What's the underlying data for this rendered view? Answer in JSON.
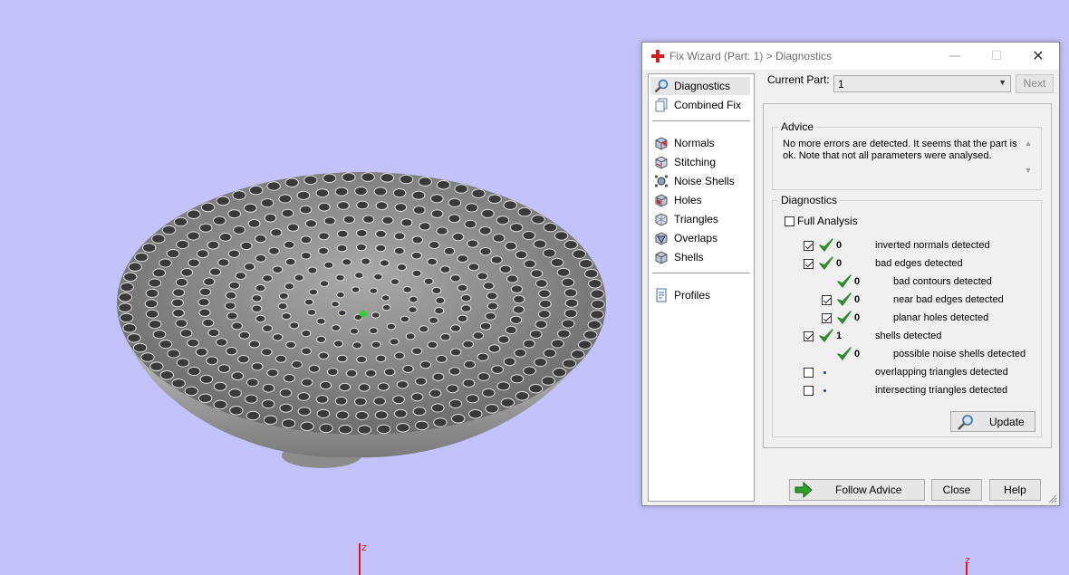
{
  "viewport": {
    "axis_labels": [
      "z",
      "z"
    ],
    "background": "#c3c2fb"
  },
  "dialog": {
    "title": "Fix Wizard (Part: 1) > Diagnostics",
    "window_buttons": {
      "minimize": "—",
      "maximize": "☐",
      "close": "✕"
    },
    "sidebar": {
      "items": [
        {
          "label": "Diagnostics",
          "icon": "magnifier-icon",
          "selected": true
        },
        {
          "label": "Combined Fix",
          "icon": "pages-icon"
        },
        {
          "label": "Normals",
          "icon": "cube-normals-icon"
        },
        {
          "label": "Stitching",
          "icon": "cube-stitch-icon"
        },
        {
          "label": "Noise Shells",
          "icon": "noise-shells-icon"
        },
        {
          "label": "Holes",
          "icon": "cube-holes-icon"
        },
        {
          "label": "Triangles",
          "icon": "triangles-icon"
        },
        {
          "label": "Overlaps",
          "icon": "overlaps-icon"
        },
        {
          "label": "Shells",
          "icon": "shells-icon"
        },
        {
          "label": "Profiles",
          "icon": "document-icon"
        }
      ]
    },
    "current_part": {
      "label": "Current Part:",
      "value": "1",
      "next_label": "Next"
    },
    "advice": {
      "title": "Advice",
      "text": "No more errors are detected. It seems that the part is ok. Note that not all parameters were analysed."
    },
    "diagnostics": {
      "title": "Diagnostics",
      "full_analysis_label": "Full Analysis",
      "full_analysis_checked": false,
      "rows": [
        {
          "checked": true,
          "status": "ok",
          "count": "0",
          "label": "inverted normals detected"
        },
        {
          "checked": true,
          "status": "ok",
          "count": "0",
          "label": "bad edges detected"
        },
        {
          "checked": null,
          "status": "ok",
          "count": "0",
          "label": "bad contours detected"
        },
        {
          "checked": true,
          "status": "ok",
          "count": "0",
          "label": "near bad edges detected"
        },
        {
          "checked": true,
          "status": "ok",
          "count": "0",
          "label": "planar holes detected"
        },
        {
          "checked": true,
          "status": "ok",
          "count": "1",
          "label": "shells detected"
        },
        {
          "checked": null,
          "status": "ok",
          "count": "0",
          "label": "possible noise shells detected"
        },
        {
          "checked": false,
          "status": "unknown",
          "count": "",
          "label": "overlapping triangles detected"
        },
        {
          "checked": false,
          "status": "unknown",
          "count": "",
          "label": "intersecting triangles detected"
        }
      ],
      "update_label": "Update"
    },
    "buttons": {
      "follow_advice": "Follow Advice",
      "close": "Close",
      "help": "Help"
    },
    "colors": {
      "check_green": "#2e8b2e",
      "dot_blue": "#1a3ac8",
      "brand_red": "#d21f1f",
      "arrow_green": "#2aa02a"
    }
  }
}
